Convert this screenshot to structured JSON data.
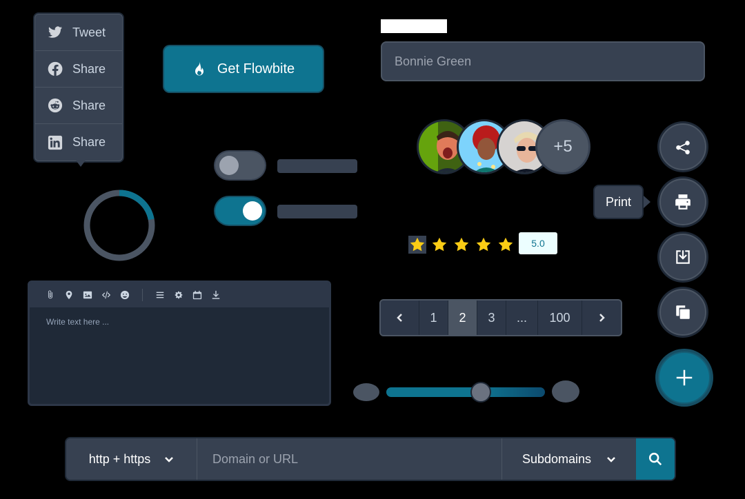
{
  "share_menu": {
    "items": [
      {
        "icon": "twitter-icon",
        "label": "Tweet"
      },
      {
        "icon": "facebook-icon",
        "label": "Share"
      },
      {
        "icon": "reddit-icon",
        "label": "Share"
      },
      {
        "icon": "linkedin-icon",
        "label": "Share"
      }
    ]
  },
  "cta": {
    "icon": "fire-icon",
    "label": "Get Flowbite"
  },
  "name_field": {
    "value": "Bonnie Green"
  },
  "toggles": [
    {
      "checked": false
    },
    {
      "checked": true
    }
  ],
  "progress": {
    "value": 0.22
  },
  "editor": {
    "toolbar": [
      "paperclip-icon",
      "map-pin-icon",
      "image-icon",
      "code-icon",
      "emoji-icon",
      "list-icon",
      "gear-icon",
      "calendar-icon",
      "download-icon"
    ],
    "placeholder": "Write text here ..."
  },
  "avatars": {
    "more_label": "+5"
  },
  "rating": {
    "stars": 5,
    "value": "5.0",
    "star_color": "#facc15"
  },
  "pagination": {
    "pages": [
      "1",
      "2",
      "3",
      "...",
      "100"
    ],
    "active": "2"
  },
  "slider": {
    "value": 0.6
  },
  "fabs": [
    {
      "icon": "share-icon"
    },
    {
      "icon": "printer-icon",
      "tooltip": "Print"
    },
    {
      "icon": "download-icon"
    },
    {
      "icon": "copy-icon"
    },
    {
      "icon": "plus-icon"
    }
  ],
  "search": {
    "protocol": "http + https",
    "placeholder": "Domain or URL",
    "scope": "Subdomains"
  },
  "colors": {
    "accent": "#0e7490",
    "surface": "#374151",
    "background": "#000000"
  }
}
